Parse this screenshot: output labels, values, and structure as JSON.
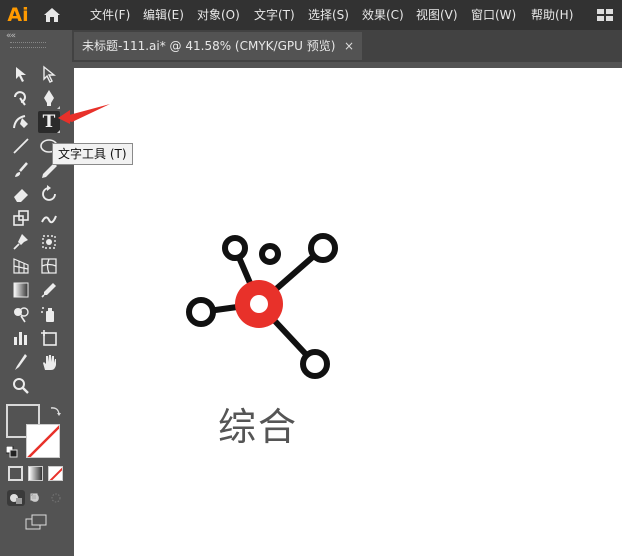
{
  "app": {
    "logo": "Ai"
  },
  "menu": [
    "文件(F)",
    "编辑(E)",
    "对象(O)",
    "文字(T)",
    "选择(S)",
    "效果(C)",
    "视图(V)",
    "窗口(W)",
    "帮助(H)"
  ],
  "panel": {
    "collapse_label": "««"
  },
  "document_tab": {
    "title": "未标题-111.ai* @ 41.58% (CMYK/GPU 预览)",
    "close_label": "×"
  },
  "tooltip": {
    "text": "文字工具 (T)"
  },
  "artboard": {
    "label": "综合"
  },
  "colors": {
    "accent": "#e8312a",
    "ui_dark": "#323232",
    "panel": "#535353",
    "arrow": "#e8312a"
  },
  "tools": [
    {
      "name": "selection-tool",
      "icon": "arrow-filled-icon"
    },
    {
      "name": "direct-selection-tool",
      "icon": "arrow-hollow-icon"
    },
    {
      "name": "magic-wand-tool",
      "icon": "wand-icon"
    },
    {
      "name": "pen-tool",
      "icon": "pen-icon"
    },
    {
      "name": "curvature-tool",
      "icon": "curvature-icon"
    },
    {
      "name": "type-tool",
      "icon": "type-icon",
      "active": true
    },
    {
      "name": "line-tool",
      "icon": "line-icon"
    },
    {
      "name": "ellipse-tool",
      "icon": "ellipse-icon"
    },
    {
      "name": "paintbrush-tool",
      "icon": "brush-icon"
    },
    {
      "name": "pencil-tool",
      "icon": "pencil-icon"
    },
    {
      "name": "eraser-tool",
      "icon": "eraser-icon"
    },
    {
      "name": "rotate-tool",
      "icon": "rotate-icon"
    },
    {
      "name": "scale-tool",
      "icon": "scale-icon"
    },
    {
      "name": "warp-tool",
      "icon": "warp-icon"
    },
    {
      "name": "puppet-warp-tool",
      "icon": "pin-icon"
    },
    {
      "name": "free-transform-tool",
      "icon": "free-transform-icon"
    },
    {
      "name": "perspective-grid-tool",
      "icon": "perspective-icon"
    },
    {
      "name": "mesh-tool",
      "icon": "mesh-icon"
    },
    {
      "name": "gradient-tool",
      "icon": "gradient-icon"
    },
    {
      "name": "eyedropper-tool",
      "icon": "eyedropper-icon"
    },
    {
      "name": "shape-builder-tool",
      "icon": "shape-builder-icon"
    },
    {
      "name": "symbol-sprayer-tool",
      "icon": "spray-icon"
    },
    {
      "name": "column-graph-tool",
      "icon": "bar-graph-icon"
    },
    {
      "name": "artboard-tool",
      "icon": "artboard-icon"
    },
    {
      "name": "slice-tool",
      "icon": "slice-icon"
    },
    {
      "name": "hand-tool",
      "icon": "hand-icon"
    },
    {
      "name": "zoom-tool",
      "icon": "zoom-icon"
    }
  ]
}
